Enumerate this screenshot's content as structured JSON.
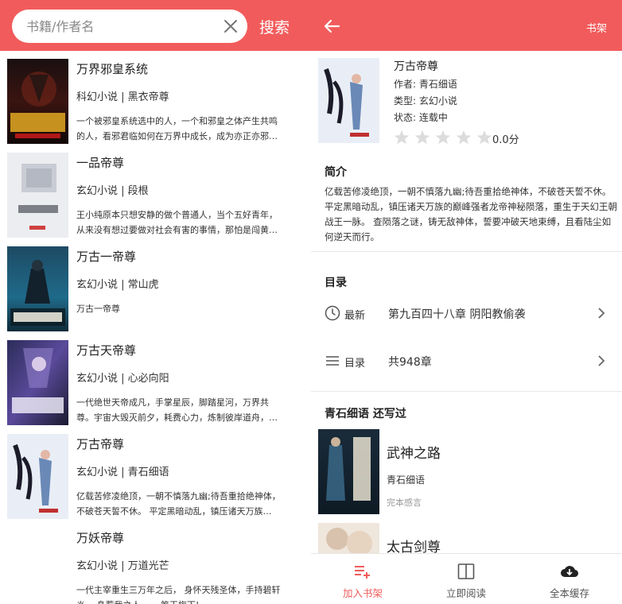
{
  "search": {
    "placeholder": "书籍/作者名",
    "button": "搜索"
  },
  "results": [
    {
      "title": "万界邪皇系统",
      "meta": "科幻小说 | 黑衣帝尊",
      "desc": "一个被邪皇系统选中的人，一个和邪皇之体产生共鸣的人，看邪君临如何在万界中成长，成为亦正亦邪…",
      "cover_text": "万界邪皇"
    },
    {
      "title": "一品帝尊",
      "meta": "玄幻小说 | 段根",
      "desc": "王小纯原本只想安静的做个普通人，当个五好青年，从来没有想过要做对社会有害的事情，那怕是闯黄…",
      "cover_text": "一品帝尊"
    },
    {
      "title": "万古一帝尊",
      "meta": "玄幻小说 | 常山虎",
      "desc": "万古一帝尊",
      "cover_text": "万古一帝尊"
    },
    {
      "title": "万古天帝尊",
      "meta": "玄幻小说 | 心必向阳",
      "desc": "一代绝世天帝成凡，手掌星辰，脚踏星河，万界共尊。宇宙大毁灭前夕，耗费心力，炼制彼岸道舟，…",
      "cover_text": "天帝尊"
    },
    {
      "title": "万古帝尊",
      "meta": "玄幻小说 | 青石细语",
      "desc": "亿载苦修凌绝顶，一朝不慎落九幽;待吾重拾绝神体，不破苍天誓不休。 平定黑暗动乱，镇压诸天万族…",
      "cover_text": "万古帝尊"
    },
    {
      "title": "万妖帝尊",
      "meta": "玄幻小说 | 万道光芒",
      "desc": "一代主宰重生三万年之后， 身怀天残圣体，手持碧轩炎… 身惹我之人 一一筹王梅下!",
      "cover_text": ""
    }
  ],
  "detail": {
    "shelf_label": "书架",
    "title": "万古帝尊",
    "author": "作者: 青石细语",
    "category": "类型: 玄幻小说",
    "status": "状态: 连载中",
    "rating_stars": 0,
    "score": "0.0分",
    "intro_title": "简介",
    "intro": "亿载苦修凌绝顶，一朝不慎落九幽;待吾重拾绝神体，不破苍天誓不休。 平定黑暗动乱，镇压诸天万族的巅峰强者龙帝神秘陨落，重生于天幻王朝战王一脉。 查陨落之谜，铸无敌神体，誓要冲破天地束缚，且看陆尘如何逆天而行。",
    "toc_title": "目录",
    "latest_label": "最新",
    "latest_value": "第九百四十八章 阴阳教偷袭",
    "toc_label": "目录",
    "toc_value": "共948章",
    "author_books_title": "青石细语  还写过",
    "other_books": [
      {
        "title": "武神之路",
        "author": "青石细语",
        "status": "完本感言"
      },
      {
        "title": "太古剑尊",
        "author": "",
        "status": ""
      }
    ]
  },
  "bottom_tabs": [
    {
      "label": "加入书架",
      "icon": "add-to-shelf-icon",
      "active": true
    },
    {
      "label": "立即阅读",
      "icon": "book-open-icon",
      "active": false
    },
    {
      "label": "全本缓存",
      "icon": "cloud-download-icon",
      "active": false
    }
  ],
  "colors": {
    "accent": "#f25b5b",
    "text": "#222222",
    "muted": "#999999"
  }
}
